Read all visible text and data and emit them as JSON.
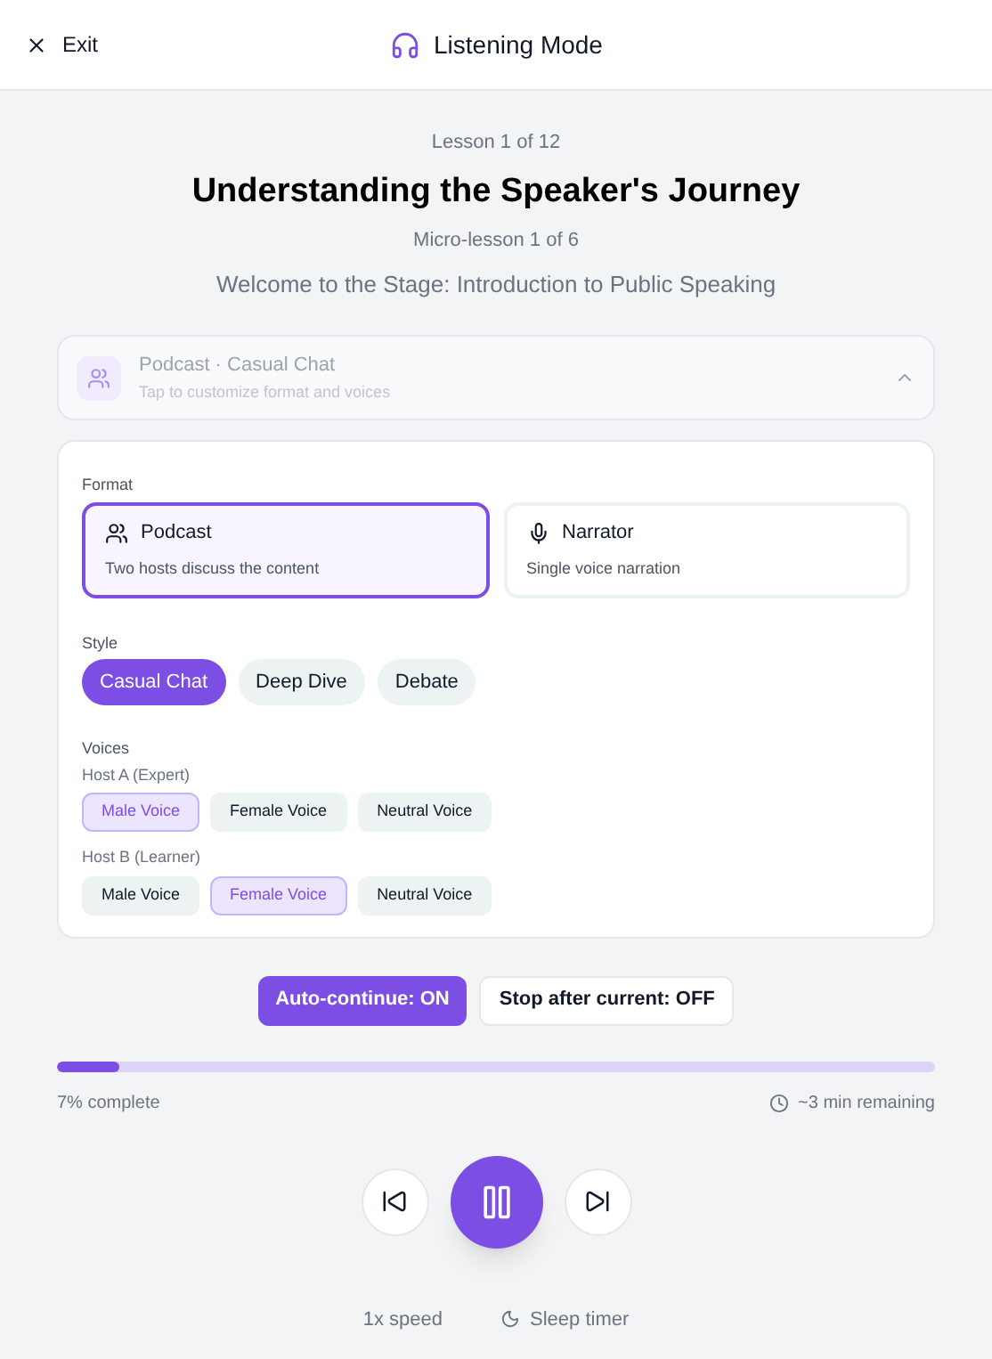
{
  "header": {
    "exit_label": "Exit",
    "title": "Listening Mode"
  },
  "lesson": {
    "counter": "Lesson 1 of 12",
    "title": "Understanding the Speaker's Journey",
    "micro_counter": "Micro-lesson 1 of 6",
    "subtitle": "Welcome to the Stage: Introduction to Public Speaking"
  },
  "summary": {
    "title": "Podcast · Casual Chat",
    "hint": "Tap to customize format and voices",
    "expanded": true
  },
  "format": {
    "label": "Format",
    "options": [
      {
        "kind": "podcast",
        "title": "Podcast",
        "description": "Two hosts discuss the content",
        "selected": true
      },
      {
        "kind": "narrator",
        "title": "Narrator",
        "description": "Single voice narration",
        "selected": false
      }
    ]
  },
  "style": {
    "label": "Style",
    "options": [
      {
        "label": "Casual Chat",
        "selected": true
      },
      {
        "label": "Deep Dive",
        "selected": false
      },
      {
        "label": "Debate",
        "selected": false
      }
    ]
  },
  "voices": {
    "label": "Voices",
    "hosts": [
      {
        "label": "Host A (Expert)",
        "options": [
          {
            "label": "Male Voice",
            "selected": true
          },
          {
            "label": "Female Voice",
            "selected": false
          },
          {
            "label": "Neutral Voice",
            "selected": false
          }
        ]
      },
      {
        "label": "Host B (Learner)",
        "options": [
          {
            "label": "Male Voice",
            "selected": false
          },
          {
            "label": "Female Voice",
            "selected": true
          },
          {
            "label": "Neutral Voice",
            "selected": false
          }
        ]
      }
    ]
  },
  "toggles": [
    {
      "label": "Auto-continue: ON",
      "on": true
    },
    {
      "label": "Stop after current: OFF",
      "on": false
    }
  ],
  "progress": {
    "level": 0.07,
    "complete_text": "7% complete",
    "remaining_text": "~3 min remaining"
  },
  "footer": {
    "speed": "1x speed",
    "sleep_timer": "Sleep timer"
  }
}
